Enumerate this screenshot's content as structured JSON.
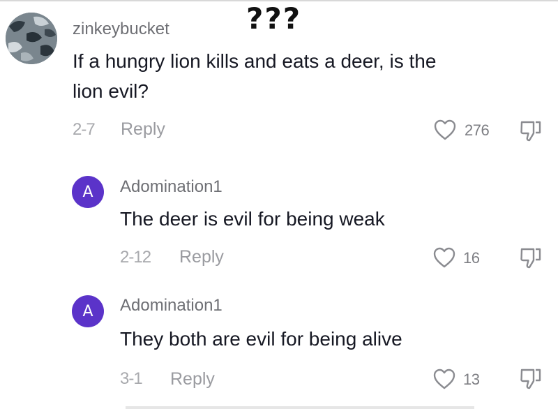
{
  "caption": "???",
  "comments": [
    {
      "username": "zinkeybucket",
      "avatar": "photo",
      "text_line1": "If a hungry lion kills and eats a deer, is the",
      "text_line2": "lion evil?",
      "date": "2-7",
      "reply_label": "Reply",
      "likes": "276"
    },
    {
      "username": "Adomination1",
      "avatar": "A",
      "text": "The deer is evil for being weak",
      "date": "2-12",
      "reply_label": "Reply",
      "likes": "16"
    },
    {
      "username": "Adomination1",
      "avatar": "A",
      "text": "They both are evil for being alive",
      "date": "3-1",
      "reply_label": "Reply",
      "likes": "13"
    }
  ],
  "icons": {
    "like": "heart-outline-icon",
    "dislike": "thumbs-down-icon"
  },
  "colors": {
    "avatar_purple": "#5b33c9",
    "secondary_text": "#a8a9ad",
    "body_text": "#161823"
  }
}
